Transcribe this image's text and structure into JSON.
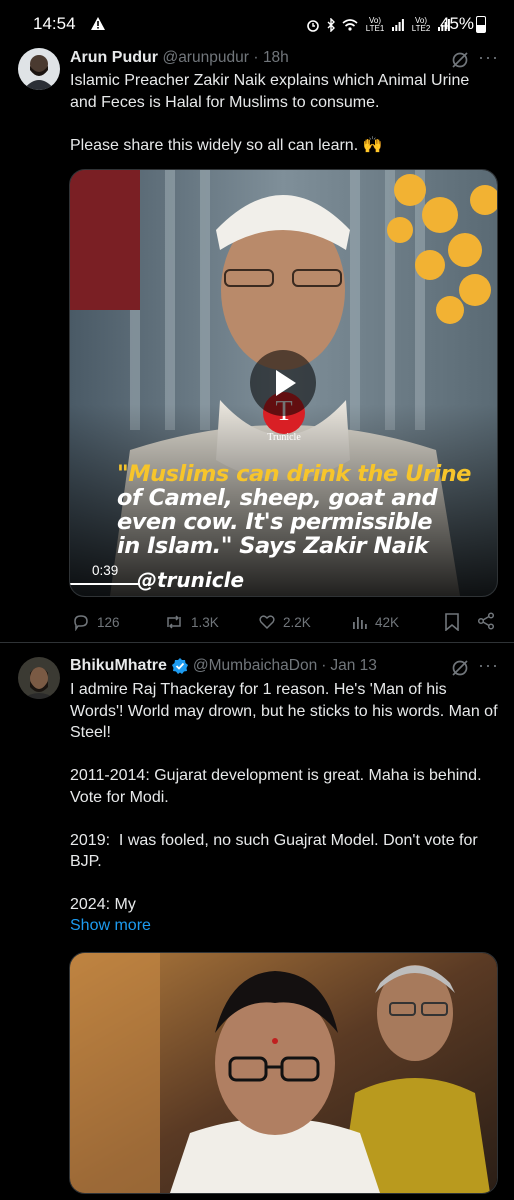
{
  "status_bar": {
    "time": "14:54",
    "network_1": "Vo) LTE1",
    "network_2": "Vo) LTE2",
    "battery": "45%",
    "battery_level": 0.45
  },
  "tweets": [
    {
      "name": "Arun Pudur",
      "handle": "@arunpudur",
      "separator": "·",
      "time": "18h",
      "text": "Islamic Preacher Zakir Naik explains which Animal Urine and Feces is Halal for Muslims to consume.\n\nPlease share this widely so all can learn. 🙌",
      "video": {
        "caption_line1": "\"Muslims can drink the Urine",
        "caption_line2": "of Camel, sheep, goat and",
        "caption_line3": "even cow. It's permissible",
        "caption_line4": "in Islam.\" Says Zakir Naik",
        "watermark": "@trunicle",
        "logo_letter": "T",
        "logo_text": "Trunicle",
        "duration": "0:39"
      },
      "replies": "126",
      "reposts": "1.3K",
      "likes": "2.2K",
      "views": "42K"
    },
    {
      "name": "BhikuMhatre",
      "handle": "@MumbaichaDon",
      "separator": "·",
      "time": "Jan 13",
      "text": "I admire Raj Thackeray for 1 reason. He's 'Man of his Words'! World may drown, but he sticks to his words. Man of Steel!\n\n2011-2014: Gujarat development is great. Maha is behind. Vote for Modi.\n\n2019:  I was fooled, no such Guajrat Model. Don't vote for BJP.\n\n2024: My",
      "show_more": "Show more"
    }
  ],
  "colors": {
    "background": "#000000",
    "text": "#e7e9ea",
    "secondary": "#71767b",
    "link": "#1d9bf0",
    "divider": "#2f3336",
    "caption_yellow": "#f7c52b",
    "verified": "#1d9bf0"
  }
}
